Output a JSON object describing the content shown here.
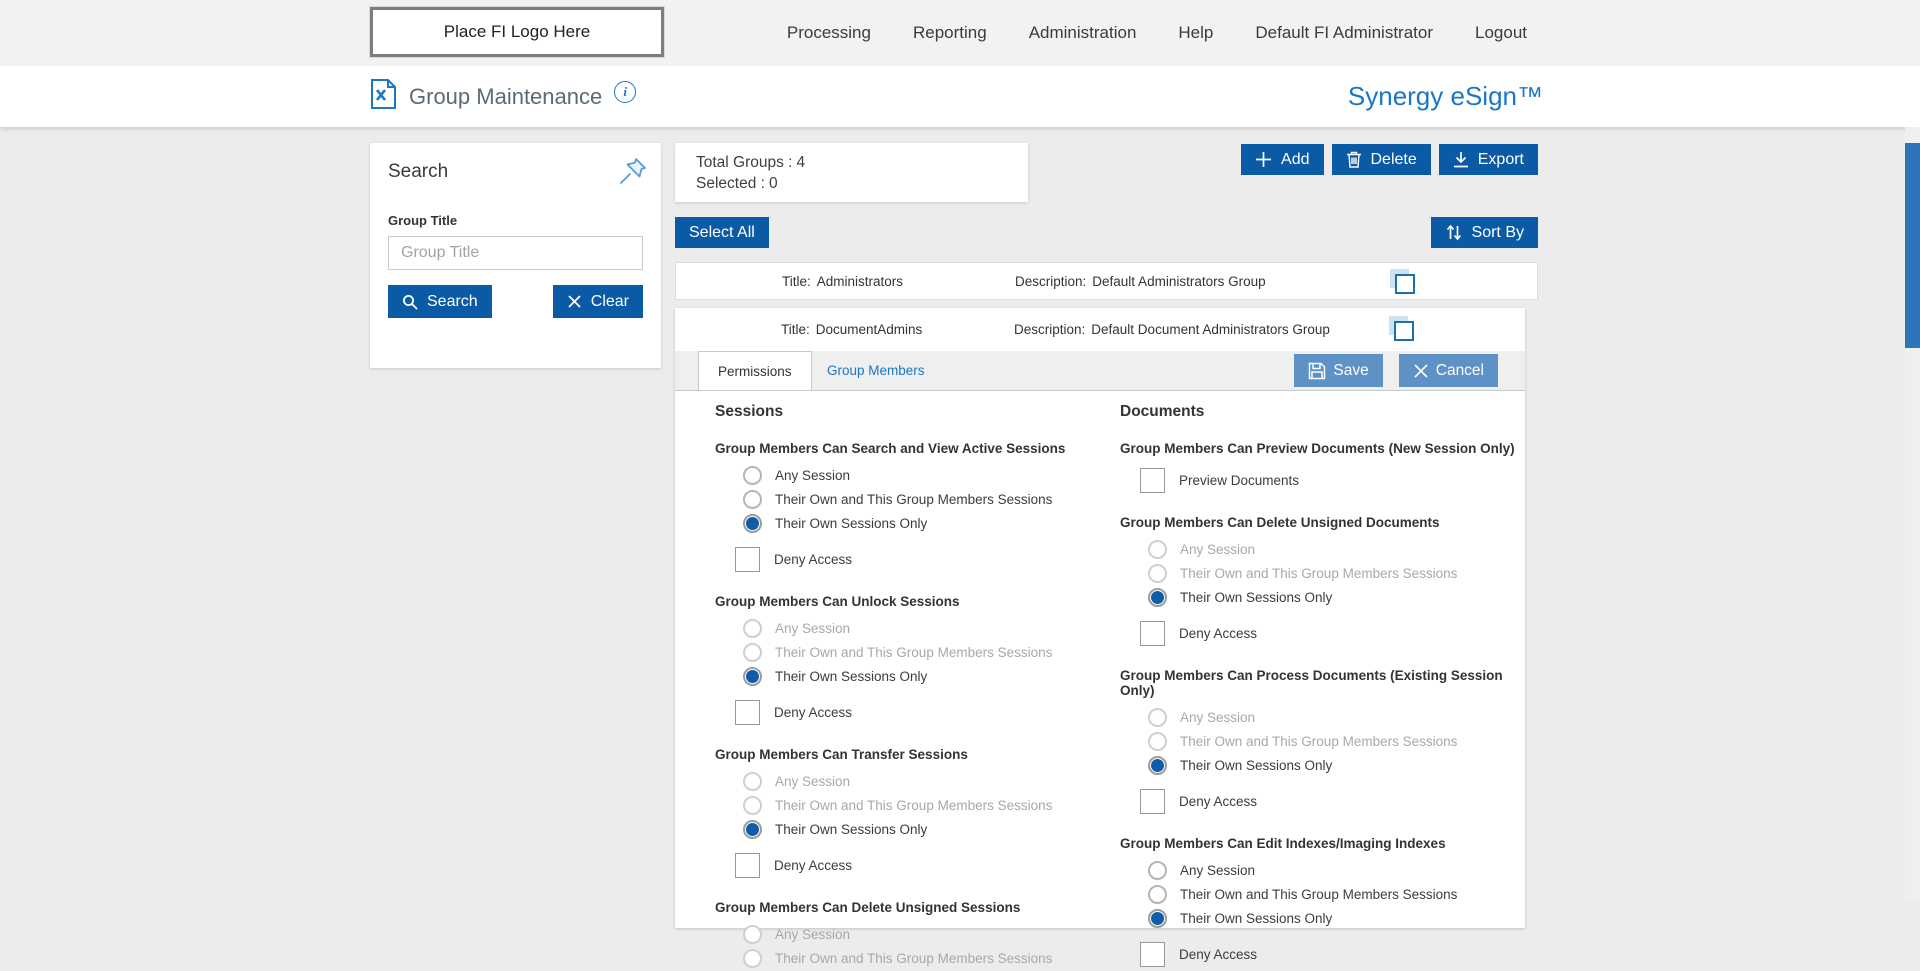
{
  "colors": {
    "primary": "#0b5aa5",
    "secondary_button": "#5e91c5",
    "link": "#1b76c5",
    "radio_selected": "#0f5ca9",
    "page_bg": "#ececec"
  },
  "topbar": {
    "logo": "Place FI Logo Here",
    "nav": [
      "Processing",
      "Reporting",
      "Administration",
      "Help",
      "Default FI Administrator",
      "Logout"
    ]
  },
  "header": {
    "title": "Group Maintenance",
    "brand": "Synergy eSign™"
  },
  "search": {
    "title": "Search",
    "field_label": "Group Title",
    "field_placeholder": "Group Title",
    "field_value": "",
    "search_label": "Search",
    "clear_label": "Clear"
  },
  "summary": {
    "total_label": "Total Groups :",
    "total_value": "4",
    "selected_label": "Selected :",
    "selected_value": "0"
  },
  "actions": {
    "add": "Add",
    "delete": "Delete",
    "export": "Export",
    "select_all": "Select All",
    "sort_by": "Sort By"
  },
  "labels": {
    "title": "Title:",
    "description": "Description:"
  },
  "groups": [
    {
      "title": "Administrators",
      "description": "Default Administrators Group"
    },
    {
      "title": "DocumentAdmins",
      "description": "Default Document Administrators Group"
    }
  ],
  "detail": {
    "tabs": [
      "Permissions",
      "Group Members"
    ],
    "active_tab": "Permissions",
    "save_label": "Save",
    "cancel_label": "Cancel"
  },
  "permissions": {
    "columns": [
      {
        "heading": "Sessions",
        "groups": [
          {
            "title": "Group Members Can Search and View Active Sessions",
            "options": [
              {
                "kind": "radio",
                "label": "Any Session",
                "disabled": false,
                "selected": false
              },
              {
                "kind": "radio",
                "label": "Their Own and This Group Members Sessions",
                "disabled": false,
                "selected": false
              },
              {
                "kind": "radio",
                "label": "Their Own Sessions Only",
                "disabled": false,
                "selected": true
              },
              {
                "kind": "checkbox",
                "label": "Deny Access",
                "checked": false
              }
            ]
          },
          {
            "title": "Group Members Can Unlock Sessions",
            "options": [
              {
                "kind": "radio",
                "label": "Any Session",
                "disabled": true,
                "selected": false
              },
              {
                "kind": "radio",
                "label": "Their Own and This Group Members Sessions",
                "disabled": true,
                "selected": false
              },
              {
                "kind": "radio",
                "label": "Their Own Sessions Only",
                "disabled": false,
                "selected": true
              },
              {
                "kind": "checkbox",
                "label": "Deny Access",
                "checked": false
              }
            ]
          },
          {
            "title": "Group Members Can Transfer Sessions",
            "options": [
              {
                "kind": "radio",
                "label": "Any Session",
                "disabled": true,
                "selected": false
              },
              {
                "kind": "radio",
                "label": "Their Own and This Group Members Sessions",
                "disabled": true,
                "selected": false
              },
              {
                "kind": "radio",
                "label": "Their Own Sessions Only",
                "disabled": false,
                "selected": true
              },
              {
                "kind": "checkbox",
                "label": "Deny Access",
                "checked": false
              }
            ]
          },
          {
            "title": "Group Members Can Delete Unsigned Sessions",
            "options": [
              {
                "kind": "radio",
                "label": "Any Session",
                "disabled": true,
                "selected": false
              },
              {
                "kind": "radio",
                "label": "Their Own and This Group Members Sessions",
                "disabled": true,
                "selected": false
              }
            ]
          }
        ]
      },
      {
        "heading": "Documents",
        "groups": [
          {
            "title": "Group Members Can Preview Documents (New Session Only)",
            "options": [
              {
                "kind": "checkbox",
                "label": "Preview Documents",
                "checked": false
              }
            ]
          },
          {
            "title": "Group Members Can Delete Unsigned Documents",
            "options": [
              {
                "kind": "radio",
                "label": "Any Session",
                "disabled": true,
                "selected": false
              },
              {
                "kind": "radio",
                "label": "Their Own and This Group Members Sessions",
                "disabled": true,
                "selected": false
              },
              {
                "kind": "radio",
                "label": "Their Own Sessions Only",
                "disabled": false,
                "selected": true
              },
              {
                "kind": "checkbox",
                "label": "Deny Access",
                "checked": false
              }
            ]
          },
          {
            "title": "Group Members Can Process Documents (Existing Session Only)",
            "options": [
              {
                "kind": "radio",
                "label": "Any Session",
                "disabled": true,
                "selected": false
              },
              {
                "kind": "radio",
                "label": "Their Own and This Group Members Sessions",
                "disabled": true,
                "selected": false
              },
              {
                "kind": "radio",
                "label": "Their Own Sessions Only",
                "disabled": false,
                "selected": true
              },
              {
                "kind": "checkbox",
                "label": "Deny Access",
                "checked": false
              }
            ]
          },
          {
            "title": "Group Members Can Edit Indexes/Imaging Indexes",
            "options": [
              {
                "kind": "radio",
                "label": "Any Session",
                "disabled": false,
                "selected": false
              },
              {
                "kind": "radio",
                "label": "Their Own and This Group Members Sessions",
                "disabled": false,
                "selected": false
              },
              {
                "kind": "radio",
                "label": "Their Own Sessions Only",
                "disabled": false,
                "selected": true
              },
              {
                "kind": "checkbox",
                "label": "Deny Access",
                "checked": false
              }
            ]
          }
        ]
      }
    ]
  }
}
